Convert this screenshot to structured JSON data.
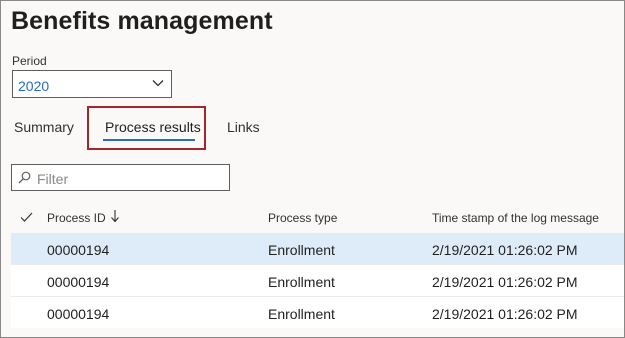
{
  "page": {
    "title": "Benefits management"
  },
  "period": {
    "label": "Period",
    "value": "2020"
  },
  "tabs": [
    {
      "label": "Summary"
    },
    {
      "label": "Process results"
    },
    {
      "label": "Links"
    }
  ],
  "filter": {
    "placeholder": "Filter"
  },
  "grid": {
    "columns": [
      "Process ID",
      "Process type",
      "Time stamp of the log message"
    ],
    "rows": [
      {
        "process_id": "00000194",
        "process_type": "Enrollment",
        "timestamp": "2/19/2021 01:26:02 PM"
      },
      {
        "process_id": "00000194",
        "process_type": "Enrollment",
        "timestamp": "2/19/2021 01:26:02 PM"
      },
      {
        "process_id": "00000194",
        "process_type": "Enrollment",
        "timestamp": "2/19/2021 01:26:02 PM"
      }
    ]
  },
  "colors": {
    "accent": "#2b6cc4",
    "highlight": "#a4262c",
    "selected_row": "#deecf9"
  },
  "icons": {
    "select": "chevron-down-icon",
    "filter": "search-icon",
    "header_check": "checkmark-icon",
    "sort": "arrow-down-icon"
  }
}
